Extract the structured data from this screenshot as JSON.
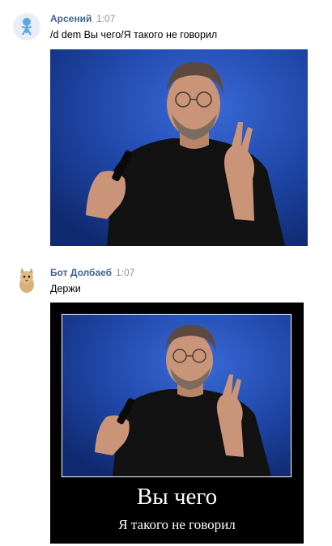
{
  "messages": [
    {
      "author": "Арсений",
      "time": "1:07",
      "text": "/d dem Вы чего/Я такого не говорил",
      "avatar_icon": "blue-figure-avatar-icon",
      "attachment": "photo"
    },
    {
      "author": "Бот Долбаеб",
      "time": "1:07",
      "text": "Держи",
      "avatar_icon": "cat-avatar-icon",
      "attachment": "demotivator",
      "demotivator": {
        "title": "Вы чего",
        "subtitle": "Я такого не говорил"
      }
    }
  ],
  "colors": {
    "author_link": "#42648b",
    "time": "#939393",
    "photo_background": "#1f47a8",
    "demotivator_frame": "#000000"
  }
}
